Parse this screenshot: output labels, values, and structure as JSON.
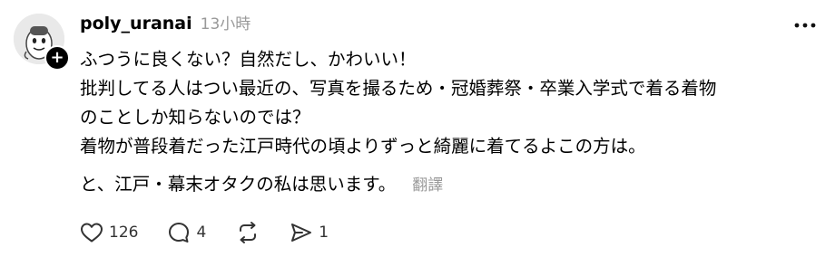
{
  "post": {
    "username": "poly_uranai",
    "timestamp": "13小時",
    "follow_badge": "+",
    "body_lines": [
      "ふつうに良くない？自然だし、かわいい！",
      "批判してる人はつい最近の、写真を撮るため・冠婚葬祭・卒業入学式で着る着物",
      "のことしか知らないのでは？",
      "着物が普段着だった江戸時代の頃よりずっと綺麗に着てるよこの方は。"
    ],
    "closing_line": "と、江戸・幕末オタクの私は思います。",
    "translate_label": "翻譯"
  },
  "actions": {
    "like_count": "126",
    "reply_count": "4",
    "share_count": "1"
  },
  "icons": {
    "avatar": "ghost-character-avatar",
    "follow": "plus-icon",
    "more": "more-dots-icon",
    "like": "heart-icon",
    "reply": "comment-bubble-icon",
    "repost": "repost-icon",
    "share": "send-icon"
  },
  "colors": {
    "text": "#000000",
    "muted": "#999999",
    "icon": "#333333"
  }
}
